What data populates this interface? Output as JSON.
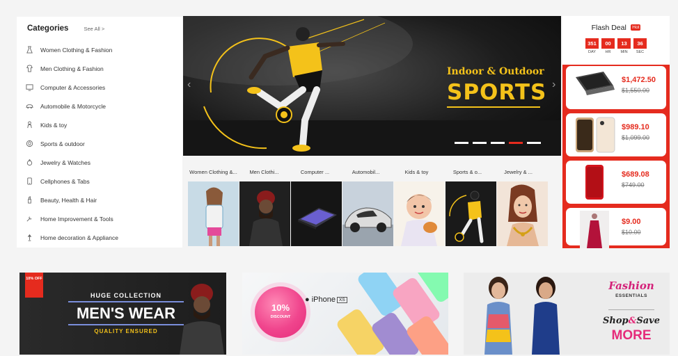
{
  "categories": {
    "title": "Categories",
    "see_all": "See All >",
    "items": [
      {
        "label": "Women Clothing & Fashion",
        "icon": "dress-icon"
      },
      {
        "label": "Men Clothing & Fashion",
        "icon": "shirt-icon"
      },
      {
        "label": "Computer & Accessories",
        "icon": "computer-icon"
      },
      {
        "label": "Automobile & Motorcycle",
        "icon": "car-icon"
      },
      {
        "label": "Kids & toy",
        "icon": "kid-icon"
      },
      {
        "label": "Sports & outdoor",
        "icon": "ball-icon"
      },
      {
        "label": "Jewelry & Watches",
        "icon": "ring-icon"
      },
      {
        "label": "Cellphones & Tabs",
        "icon": "phone-icon"
      },
      {
        "label": "Beauty, Health & Hair",
        "icon": "beauty-icon"
      },
      {
        "label": "Home Improvement & Tools",
        "icon": "tools-icon"
      },
      {
        "label": "Home decoration & Appliance",
        "icon": "lamp-icon"
      }
    ]
  },
  "hero": {
    "subtitle": "Indoor & Outdoor",
    "title": "SPORTS",
    "prev_arrow": "‹",
    "next_arrow": "›",
    "slides_count": 5,
    "active_slide": 4,
    "accent_color": "#f4c21a"
  },
  "category_thumbs": [
    {
      "label": "Women Clothing &..."
    },
    {
      "label": "Men Clothi..."
    },
    {
      "label": "Computer ..."
    },
    {
      "label": "Automobil..."
    },
    {
      "label": "Kids & toy"
    },
    {
      "label": "Sports & o..."
    },
    {
      "label": "Jewelry & ..."
    }
  ],
  "flash_deal": {
    "title": "Flash Deal",
    "hot_badge": "Hot",
    "timer": [
      {
        "value": "351",
        "label": "DAY"
      },
      {
        "value": "00",
        "label": "HR"
      },
      {
        "value": "13",
        "label": "MIN"
      },
      {
        "value": "36",
        "label": "SEC"
      }
    ],
    "items": [
      {
        "price": "$1,472.50",
        "old_price": "$1,550.00",
        "product": "laptop"
      },
      {
        "price": "$989.10",
        "old_price": "$1,099.00",
        "product": "iphone"
      },
      {
        "price": "$689.08",
        "old_price": "$749.00",
        "product": "red-phone"
      },
      {
        "price": "$9.00",
        "old_price": "$10.00",
        "product": "dress"
      }
    ],
    "accent_color": "#e52b1e"
  },
  "promos": {
    "mens": {
      "ribbon": "10% OFF",
      "tagline": "HUGE COLLECTION",
      "title": "MEN'S WEAR",
      "subtitle": "QUALITY ENSURED"
    },
    "iphone": {
      "discount_pct": "10%",
      "discount_label": "DISCOUNT",
      "brand": "iPhone",
      "model": "XS"
    },
    "fashion": {
      "title": "Fashion",
      "subtitle": "ESSENTIALS",
      "shop": "Shop",
      "amp": "&",
      "save": "Save",
      "more": "MORE"
    }
  }
}
